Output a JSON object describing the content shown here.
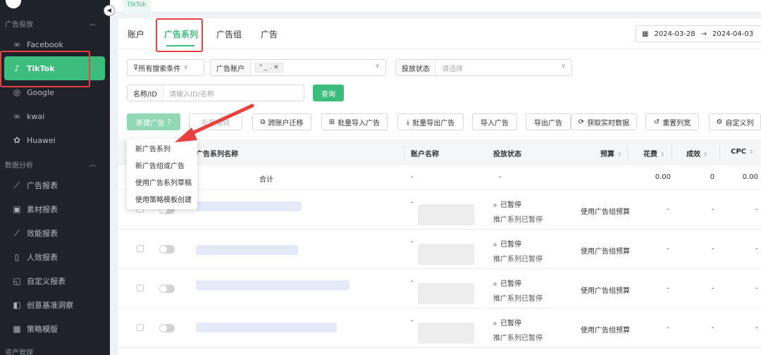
{
  "sidebar": {
    "section_ads": "广告投放",
    "section_analysis": "数据分析",
    "section_assets": "资产管理",
    "items": [
      {
        "label": "Facebook",
        "icon": "meta-icon"
      },
      {
        "label": "TikTok",
        "icon": "tiktok-icon"
      },
      {
        "label": "Google",
        "icon": "google-icon"
      },
      {
        "label": "kwai",
        "icon": "kwai-icon"
      },
      {
        "label": "Huawei",
        "icon": "huawei-icon"
      }
    ],
    "analysis_items": [
      {
        "label": "广告报表",
        "icon": "chart-icon"
      },
      {
        "label": "素材报表",
        "icon": "image-icon"
      },
      {
        "label": "效能报表",
        "icon": "trend-icon"
      },
      {
        "label": "人效报表",
        "icon": "doc-icon"
      },
      {
        "label": "自定义报表",
        "icon": "custom-chart-icon"
      },
      {
        "label": "创意基准洞察",
        "icon": "insight-icon"
      },
      {
        "label": "策略模版",
        "icon": "template-icon"
      }
    ]
  },
  "topbar": {
    "tab": "TikTok"
  },
  "tabs": [
    "账户",
    "广告系列",
    "广告组",
    "广告"
  ],
  "date_range": {
    "start": "2024-03-28",
    "sep": "→",
    "end": "2024-04-03"
  },
  "filters": {
    "all_search": "所有搜索条件",
    "ad_account_label": "广告账户",
    "ad_account_tag": "\" _ .",
    "status_label": "投放状态",
    "status_placeholder": "请选择",
    "name_label": "名称/ID",
    "name_placeholder": "请输入ID/名称",
    "query_button": "查询"
  },
  "toolbar": {
    "new_ad": "新建广告",
    "bulk_edit": "批量编辑",
    "cross_account": "跨账户迁移",
    "bulk_import": "批量导入广告",
    "bulk_export": "批量导出广告",
    "import_ad": "导入广告",
    "export_ad": "导出广告",
    "realtime": "获取实时数据",
    "reset_width": "重置列宽",
    "custom_cols": "自定义列"
  },
  "dropdown": [
    "新广告系列",
    "新广告组或广告",
    "使用广告系列草稿",
    "使用策略模板创建"
  ],
  "table": {
    "headers": {
      "name": "广告系列名称",
      "account": "账户名称",
      "status": "投放状态",
      "budget": "预算",
      "spend": "花费",
      "results": "成效",
      "cpc": "CPC"
    },
    "total": {
      "label": "合计",
      "account": "-",
      "status": "-",
      "spend": "0.00",
      "results": "0",
      "cpc": "0.00"
    },
    "rows": [
      {
        "account": "-",
        "status": "已暂停",
        "sub_status": "推广系列已暂停",
        "budget": "使用广告组预算",
        "spend": "-",
        "results": "-",
        "cpc": "-"
      },
      {
        "account": "-",
        "status": "已暂停",
        "sub_status": "推广系列已暂停",
        "budget": "使用广告组预算",
        "spend": "-",
        "results": "-",
        "cpc": "-"
      },
      {
        "account": "-",
        "status": "已暂停",
        "sub_status": "推广系列已暂停",
        "budget": "使用广告组预算",
        "spend": "-",
        "results": "-",
        "cpc": "-"
      },
      {
        "account": "-",
        "status": "已暂停",
        "sub_status": "推广系列已暂停",
        "budget": "使用广告组预算",
        "spend": "-",
        "results": "-",
        "cpc": "-"
      }
    ]
  },
  "colors": {
    "accent": "#3dbd7d",
    "highlight": "#e8413e",
    "sidebar": "#1f2329"
  }
}
